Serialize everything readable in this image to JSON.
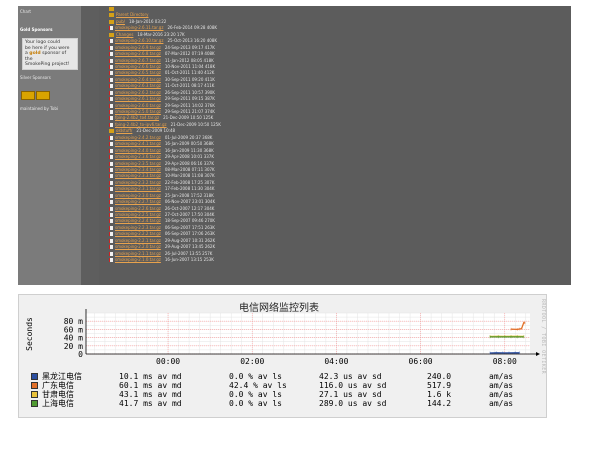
{
  "top_panel": {
    "sidebar": {
      "top_text": "Chart",
      "gold_heading": "Gold Sponsors",
      "gold_box": [
        "Your logo could",
        "be here if you were",
        "a",
        "gold",
        "sponsor of the",
        "SmokePing project!"
      ],
      "silver_heading": "Silver Sponsors",
      "footer_text": "maintained by Tobi"
    },
    "files": [
      {
        "type": "folder",
        "name": "",
        "date": ""
      },
      {
        "type": "folder",
        "name": "Parent Directory",
        "date": ""
      },
      {
        "type": "folder",
        "name": "pub/",
        "date": "18-Jan-2016 03:22"
      },
      {
        "type": "file",
        "name": "smokeping-2.6.11.tar.gz",
        "date": "26-Feb-2014 09:28  408K"
      },
      {
        "type": "folder",
        "name": "Changes",
        "date": "18-Mar-2016 23:20  17K"
      },
      {
        "type": "file",
        "name": "smokeping-2.6.10.tar.gz",
        "date": "25-Oct-2013 16:20  408K"
      },
      {
        "type": "file",
        "name": "smokeping-2.6.9.tar.gz",
        "date": "24-Sep-2013 09:17  417K"
      },
      {
        "type": "file",
        "name": "smokeping-2.6.8.tar.gz",
        "date": "07-Mar-2012 07:19  408K"
      },
      {
        "type": "file",
        "name": "smokeping-2.6.7.tar.gz",
        "date": "11-Jan-2012 08:05  418K"
      },
      {
        "type": "file",
        "name": "smokeping-2.6.6.tar.gz",
        "date": "10-Nov-2011 11:04  418K"
      },
      {
        "type": "file",
        "name": "smokeping-2.6.5.tar.gz",
        "date": "01-Oct-2011 11:40  412K"
      },
      {
        "type": "file",
        "name": "smokeping-2.6.4.tar.gz",
        "date": "30-Sep-2011 09:20  411K"
      },
      {
        "type": "file",
        "name": "smokeping-2.6.3.tar.gz",
        "date": "11-Oct-2011 08:17  411K"
      },
      {
        "type": "file",
        "name": "smokeping-2.6.2.tar.gz",
        "date": "26-Sep-2011 10:57  390K"
      },
      {
        "type": "file",
        "name": "smokeping-2.6.1.tar.gz",
        "date": "29-Sep-2011 09:15  387K"
      },
      {
        "type": "file",
        "name": "smokeping-2.6.0.tar.gz",
        "date": "29-Sep-2011 14:02  376K"
      },
      {
        "type": "file",
        "name": "smokeping-2.5.0.tar.gz",
        "date": "29-Sep-2011 21:07  374K"
      },
      {
        "type": "file",
        "name": "fping-2.4b2_to4.tar.gz",
        "date": "21-Dec-2009 10:50  125K"
      },
      {
        "type": "file",
        "name": "fping-2.4b2_to-ipv6.tar.gz",
        "date": "21-Dec-2009 10:50  125K"
      },
      {
        "type": "folder",
        "name": "oldstuff/",
        "date": "21-Dec-2009 10:48"
      },
      {
        "type": "file",
        "name": "smokeping-2.4.2.tar.gz",
        "date": "01-Jul-2009 20:37  368K"
      },
      {
        "type": "file",
        "name": "smokeping-2.4.1.tar.gz",
        "date": "16-Jan-2009 00:50  368K"
      },
      {
        "type": "file",
        "name": "smokeping-2.4.0.tar.gz",
        "date": "16-Jan-2009 11:30  368K"
      },
      {
        "type": "file",
        "name": "smokeping-2.3.6.tar.gz",
        "date": "29-Apr-2008 10:01  337K"
      },
      {
        "type": "file",
        "name": "smokeping-2.3.5.tar.gz",
        "date": "29-Apr-2008 06:16  337K"
      },
      {
        "type": "file",
        "name": "smokeping-2.3.4.tar.gz",
        "date": "08-Mar-2008 07:11  307K"
      },
      {
        "type": "file",
        "name": "smokeping-2.3.3.tar.gz",
        "date": "10-Mar-2008 11:08  307K"
      },
      {
        "type": "file",
        "name": "smokeping-2.3.2.tar.gz",
        "date": "22-Feb-2008 17:25  307K"
      },
      {
        "type": "file",
        "name": "smokeping-2.3.1.tar.gz",
        "date": "17-Feb-2008 11:30  304K"
      },
      {
        "type": "file",
        "name": "smokeping-2.3.0.tar.gz",
        "date": "25-Jan-2008 17:52  318K"
      },
      {
        "type": "file",
        "name": "smokeping-2.2.7.tar.gz",
        "date": "06-Nov-2007 23:01  304K"
      },
      {
        "type": "file",
        "name": "smokeping-2.2.6.tar.gz",
        "date": "26-Oct-2007 12:17  304K"
      },
      {
        "type": "file",
        "name": "smokeping-2.2.5.tar.gz",
        "date": "27-Oct-2007 17:50  304K"
      },
      {
        "type": "file",
        "name": "smokeping-2.2.4.tar.gz",
        "date": "18-Sep-2007 09:46  270K"
      },
      {
        "type": "file",
        "name": "smokeping-2.2.3.tar.gz",
        "date": "06-Sep-2007 17:51  263K"
      },
      {
        "type": "file",
        "name": "smokeping-2.2.2.tar.gz",
        "date": "06-Sep-2007 17:06  263K"
      },
      {
        "type": "file",
        "name": "smokeping-2.2.1.tar.gz",
        "date": "29-Aug-2007 10:31  262K"
      },
      {
        "type": "file",
        "name": "smokeping-2.2.0.tar.gz",
        "date": "29-Aug-2007 13:45  262K"
      },
      {
        "type": "file",
        "name": "smokeping-2.1.1.tar.gz",
        "date": "26-Jul-2007 13:55  257K"
      },
      {
        "type": "file",
        "name": "smokeping-2.1.0.tar.gz",
        "date": "16-Jun-2007 13:15  253K"
      }
    ]
  },
  "graph_panel": {
    "title": "电信网络监控列表",
    "rrd_label": "RRDTOOL / TOBI OETIKER",
    "chart_data": {
      "type": "line",
      "ylabel": "Seconds",
      "ylim": [
        0,
        100
      ],
      "yticks": [
        "0",
        "20 m",
        "40 m",
        "60 m",
        "80 m"
      ],
      "yticks_values": [
        0,
        20,
        40,
        60,
        80
      ],
      "xticks": [
        "00:00",
        "02:00",
        "04:00",
        "06:00",
        "08:00"
      ],
      "xrange_hours": [
        -1.95,
        8.6
      ],
      "grid": true,
      "series": [
        {
          "name": "黑龙江电信",
          "color": "#2b4fa0",
          "avg_ms": 10.1,
          "loss": "0.0 %",
          "sd": "42.3 us",
          "ratio": "240.0",
          "points": [
            [
              7.65,
              2.5
            ],
            [
              7.8,
              3
            ],
            [
              7.95,
              2.8
            ],
            [
              8.1,
              2.6
            ],
            [
              8.25,
              2.9
            ],
            [
              8.35,
              3
            ]
          ]
        },
        {
          "name": "广东电信",
          "color": "#e2702a",
          "avg_ms": 60.1,
          "loss": "42.4 %",
          "sd": "116.0 us",
          "ratio": "517.9",
          "points": [
            [
              8.15,
              60.5
            ],
            [
              8.3,
              60
            ],
            [
              8.35,
              61
            ],
            [
              8.4,
              62
            ],
            [
              8.45,
              76
            ],
            [
              8.48,
              76
            ]
          ]
        },
        {
          "name": "甘肃电信",
          "color": "#e8c13a",
          "avg_ms": 43.1,
          "loss": "0.0 %",
          "sd": "27.1 us",
          "ratio": "1.6 k",
          "points": [
            [
              7.65,
              43
            ],
            [
              7.85,
              43.2
            ],
            [
              8.0,
              42.9
            ],
            [
              8.15,
              43.1
            ],
            [
              8.3,
              43.2
            ],
            [
              8.45,
              43
            ]
          ]
        },
        {
          "name": "上海电信",
          "color": "#4f9a31",
          "avg_ms": 41.7,
          "loss": "0.0 %",
          "sd": "289.0 us",
          "ratio": "144.2",
          "points": [
            [
              7.65,
              41.7
            ],
            [
              7.85,
              41.8
            ],
            [
              8.0,
              41.6
            ],
            [
              8.15,
              41.8
            ],
            [
              8.3,
              41.7
            ],
            [
              8.45,
              41.7
            ]
          ]
        }
      ]
    },
    "legend_rows": [
      {
        "name": "黑龙江电信",
        "avg": "10.1 ms av md",
        "loss": "0.0 % av ls",
        "sd": "42.3 us av sd",
        "ratio": "240.0",
        "unit": "am/as",
        "color": "#2b4fa0"
      },
      {
        "name": "广东电信",
        "avg": "60.1 ms av md",
        "loss": "42.4 % av ls",
        "sd": "116.0 us av sd",
        "ratio": "517.9",
        "unit": "am/as",
        "color": "#e2702a"
      },
      {
        "name": "甘肃电信",
        "avg": "43.1 ms av md",
        "loss": "0.0 % av ls",
        "sd": "27.1 us av sd",
        "ratio": "1.6 k",
        "unit": "am/as",
        "color": "#e8c13a"
      },
      {
        "name": "上海电信",
        "avg": "41.7 ms av md",
        "loss": "0.0 % av ls",
        "sd": "289.0 us av sd",
        "ratio": "144.2",
        "unit": "am/as",
        "color": "#4f9a31"
      }
    ]
  }
}
